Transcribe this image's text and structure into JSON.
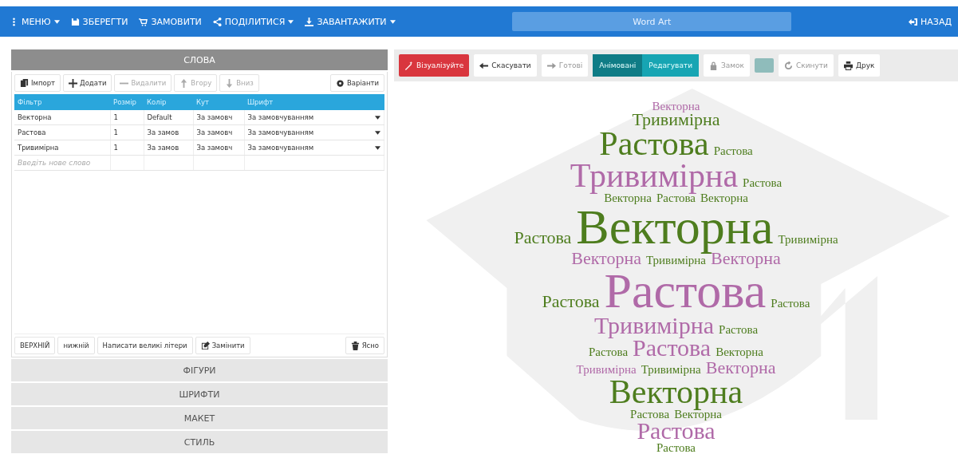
{
  "navbar": {
    "menus": [
      {
        "label": "МЕНЮ",
        "dropdown": true
      },
      {
        "label": "ЗБЕРЕГТИ",
        "dropdown": false
      },
      {
        "label": "ЗАМОВИТИ",
        "dropdown": false
      },
      {
        "label": "ПОДІЛИТИСЯ",
        "dropdown": true
      },
      {
        "label": "ЗАВАНТАЖИТИ",
        "dropdown": true
      }
    ],
    "title": "Word Art",
    "back": "НАЗАД"
  },
  "sections": [
    {
      "title": "СЛОВА",
      "expanded": true
    },
    {
      "title": "ФІГУРИ",
      "expanded": false
    },
    {
      "title": "ШРИФТИ",
      "expanded": false
    },
    {
      "title": "МАКЕТ",
      "expanded": false
    },
    {
      "title": "СТИЛЬ",
      "expanded": false
    }
  ],
  "words_toolbar": [
    {
      "label": "Імпорт",
      "disabled": false
    },
    {
      "label": "Додати",
      "disabled": false
    },
    {
      "label": "Видалити",
      "disabled": true
    },
    {
      "label": "Вгору",
      "disabled": true
    },
    {
      "label": "Вниз",
      "disabled": true
    }
  ],
  "options_button": "Варіанти",
  "table": {
    "columns": [
      "Фільтр",
      "Розмір",
      "Колір",
      "Кут",
      "Шрифт"
    ],
    "rows": [
      [
        "Векторна",
        "1",
        "Default",
        "За замовч",
        "За замовчуванням"
      ],
      [
        "Растова",
        "1",
        "За замов",
        "За замовч",
        "За замовчуванням"
      ],
      [
        "Тривимірна",
        "1",
        "За замов",
        "За замовч",
        "За замовчуванням"
      ]
    ],
    "new_word_placeholder": "Введіть нове слово"
  },
  "case_buttons": [
    "ВЕРХНІЙ",
    "нижній",
    "Написати великі літери",
    "Замінити"
  ],
  "clear_button": "Ясно",
  "art_toolbar": [
    {
      "kind": "primary",
      "label": "Візуалізуйте",
      "disabled": false
    },
    {
      "kind": "button",
      "label": "Скасувати",
      "disabled": false
    },
    {
      "kind": "button",
      "label": "Готові",
      "disabled": true
    },
    {
      "kind": "toggle",
      "label": "Анімовані",
      "selected": true
    },
    {
      "kind": "toggle",
      "label": "Редагувати",
      "selected": false
    },
    {
      "kind": "button",
      "label": "Замок",
      "disabled": true
    },
    {
      "kind": "swatch",
      "color": "#8fbcbb"
    },
    {
      "kind": "button",
      "label": "Скинути",
      "disabled": true
    },
    {
      "kind": "button",
      "label": "Друк",
      "disabled": false
    }
  ],
  "cloud": {
    "rows": [
      [
        {
          "text": "Векторна",
          "kind": "small",
          "color": "#b06aa8"
        }
      ],
      [
        {
          "text": "Тривимірна",
          "kind": "medium",
          "color": "#4e7d1e"
        }
      ],
      [
        {
          "text": "Растова",
          "kind": "xlarge",
          "color": "#4e7d1e"
        },
        {
          "text": "Растова",
          "kind": "small",
          "color": "#4e7d1e"
        }
      ],
      [
        {
          "text": "Тривимірна",
          "kind": "xlarge",
          "color": "#b06aa8"
        },
        {
          "text": "Растова",
          "kind": "small",
          "color": "#4e7d1e"
        }
      ],
      [
        {
          "text": "Векторна",
          "kind": "small",
          "color": "#4e7d1e"
        },
        {
          "text": "Растова",
          "kind": "small",
          "color": "#4e7d1e"
        },
        {
          "text": "Векторна",
          "kind": "small",
          "color": "#4e7d1e"
        }
      ],
      [
        {
          "text": "Растова",
          "kind": "medium",
          "color": "#4e7d1e"
        },
        {
          "text": "Векторна",
          "kind": "huge",
          "color": "#4e7d1e"
        },
        {
          "text": "Тривимірна",
          "kind": "small",
          "color": "#4e7d1e"
        }
      ],
      [
        {
          "text": "Векторна",
          "kind": "medium",
          "color": "#b06aa8"
        },
        {
          "text": "Тривимірна",
          "kind": "small",
          "color": "#4e7d1e"
        },
        {
          "text": "Векторна",
          "kind": "medium",
          "color": "#b06aa8"
        }
      ],
      [
        {
          "text": "Растова",
          "kind": "medium",
          "color": "#4e7d1e"
        },
        {
          "text": "Растова",
          "kind": "huge",
          "color": "#b06aa8"
        },
        {
          "text": "Растова",
          "kind": "small",
          "color": "#4e7d1e"
        }
      ],
      [
        {
          "text": "Тривимірна",
          "kind": "large",
          "color": "#b06aa8"
        },
        {
          "text": "Растова",
          "kind": "small",
          "color": "#4e7d1e"
        }
      ],
      [
        {
          "text": "Растова",
          "kind": "small",
          "color": "#4e7d1e"
        },
        {
          "text": "Растова",
          "kind": "large",
          "color": "#b06aa8"
        },
        {
          "text": "Векторна",
          "kind": "small",
          "color": "#4e7d1e"
        }
      ],
      [
        {
          "text": "Тривимірна",
          "kind": "small",
          "color": "#b06aa8"
        },
        {
          "text": "Тривимірна",
          "kind": "small",
          "color": "#4e7d1e"
        },
        {
          "text": "Векторна",
          "kind": "medium",
          "color": "#b06aa8"
        }
      ],
      [
        {
          "text": "Векторна",
          "kind": "xlarge",
          "color": "#4e7d1e"
        }
      ],
      [
        {
          "text": "Растова",
          "kind": "small",
          "color": "#4e7d1e"
        },
        {
          "text": "Векторна",
          "kind": "small",
          "color": "#4e7d1e"
        }
      ],
      [
        {
          "text": "Растова",
          "kind": "large",
          "color": "#b06aa8"
        }
      ],
      [
        {
          "text": "Растова",
          "kind": "small",
          "color": "#4e7d1e"
        }
      ]
    ]
  }
}
